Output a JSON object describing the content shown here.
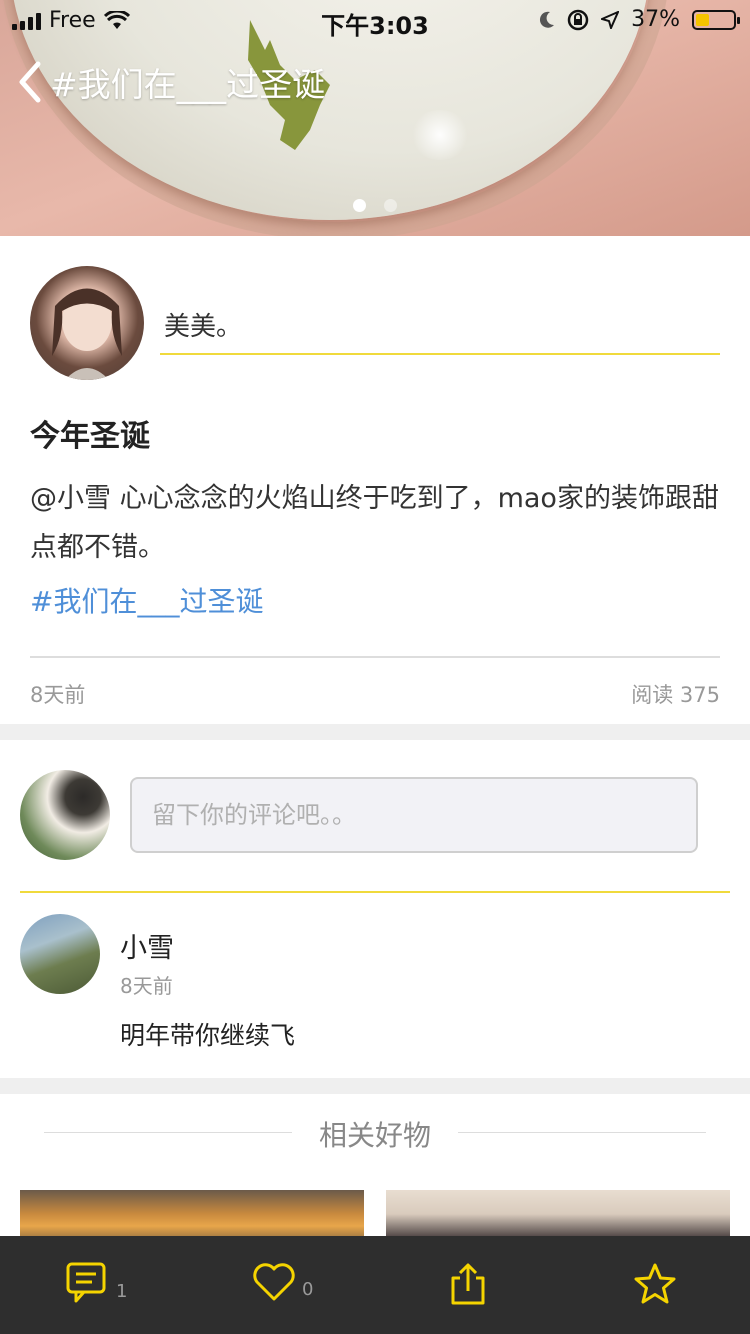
{
  "status_bar": {
    "carrier": "Free",
    "time": "下午3:03",
    "battery": "37%",
    "battery_level": 0.37
  },
  "nav": {
    "title": "#我们在___过圣诞"
  },
  "carousel": {
    "current": 1,
    "total": 2
  },
  "post": {
    "author": "美美。",
    "title": "今年圣诞",
    "body": "@小雪 心心念念的火焰山终于吃到了，mao家的装饰跟甜点都不错。",
    "hashtag": "#我们在___过圣诞",
    "time": "8天前",
    "reads": "阅读 375"
  },
  "comments": {
    "input_placeholder": "留下你的评论吧。。",
    "items": [
      {
        "name": "小雪",
        "time": "8天前",
        "text": "明年带你继续飞"
      }
    ]
  },
  "related": {
    "title": "相关好物"
  },
  "tabbar": {
    "comment_count": "1",
    "like_count": "0"
  },
  "colors": {
    "accent_yellow": "#f5d400",
    "link_blue": "#4f8fd8",
    "tabbar_bg": "#2e2e2e"
  }
}
